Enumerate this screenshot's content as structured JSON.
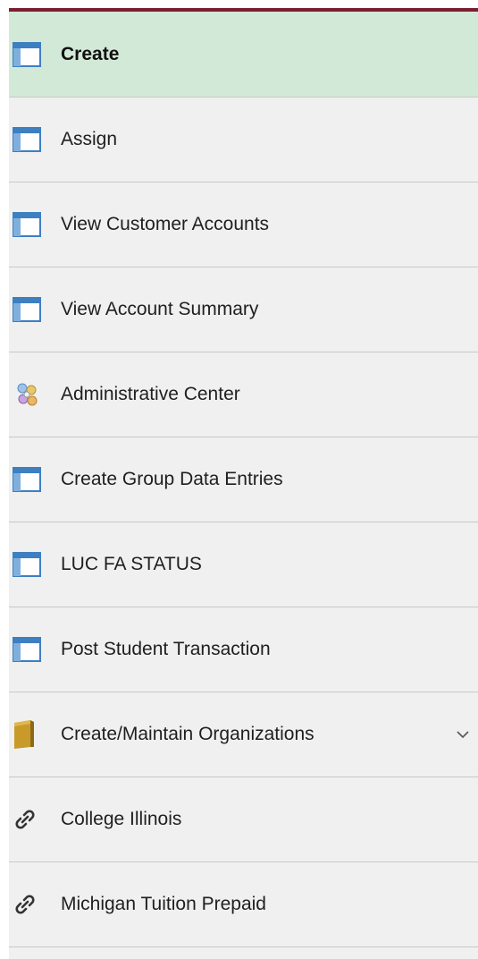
{
  "menu": {
    "items": [
      {
        "label": "Create",
        "icon": "page-icon",
        "selected": true
      },
      {
        "label": "Assign",
        "icon": "page-icon"
      },
      {
        "label": "View Customer Accounts",
        "icon": "page-icon"
      },
      {
        "label": "View Account Summary",
        "icon": "page-icon"
      },
      {
        "label": "Administrative Center",
        "icon": "work-center-icon"
      },
      {
        "label": "Create Group Data Entries",
        "icon": "page-icon"
      },
      {
        "label": "LUC FA STATUS",
        "icon": "page-icon"
      },
      {
        "label": "Post Student Transaction",
        "icon": "page-icon"
      },
      {
        "label": "Create/Maintain Organizations",
        "icon": "folder-icon",
        "expandable": true
      },
      {
        "label": "College Illinois",
        "icon": "link-icon"
      },
      {
        "label": "Michigan Tuition Prepaid",
        "icon": "link-icon"
      }
    ]
  },
  "colors": {
    "selected_background": "#d3e9d7",
    "item_background": "#f0f0f0",
    "divider": "#c8c8c8",
    "accent_bar": "#7a1e30",
    "page_icon_blue": "#3d7fc1",
    "folder_gold": "#c89a2a"
  }
}
